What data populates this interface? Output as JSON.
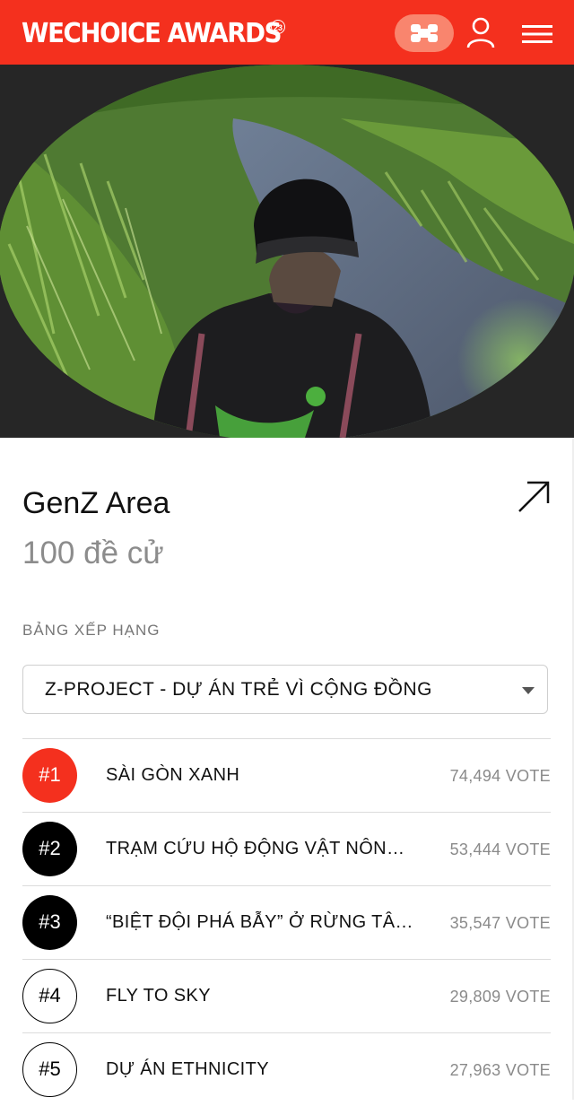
{
  "header": {
    "brand": "WECHOICE AWARDS",
    "brand_badge": "23",
    "background": "#f4301e"
  },
  "hero": {
    "image_subject": "volunteer-by-canal-photo"
  },
  "category": {
    "title": "GenZ Area",
    "nominee_count": "100 đề cử"
  },
  "ranking": {
    "label": "BẢNG XẾP HẠNG",
    "dropdown_value": "Z-PROJECT - DỰ ÁN TRẺ VÌ CỘNG ĐỒNG",
    "items": [
      {
        "rank": "#1",
        "name": "SÀI GÒN XANH",
        "votes": "74,494 VOTE"
      },
      {
        "rank": "#2",
        "name": "TRẠM CỨU HỘ ĐỘNG VẬT NÔNG …",
        "votes": "53,444 VOTE"
      },
      {
        "rank": "#3",
        "name": "“BIỆT ĐỘI PHÁ BẪY” Ở RỪNG TÂY …",
        "votes": "35,547 VOTE"
      },
      {
        "rank": "#4",
        "name": "FLY TO SKY",
        "votes": "29,809 VOTE"
      },
      {
        "rank": "#5",
        "name": "DỰ ÁN ETHNICITY",
        "votes": "27,963 VOTE"
      }
    ]
  },
  "icons": {
    "logo": "wechoice-logo-icon",
    "user": "user-icon",
    "menu": "hamburger-menu-icon",
    "share": "arrow-up-right-icon",
    "caret": "caret-down-icon"
  }
}
